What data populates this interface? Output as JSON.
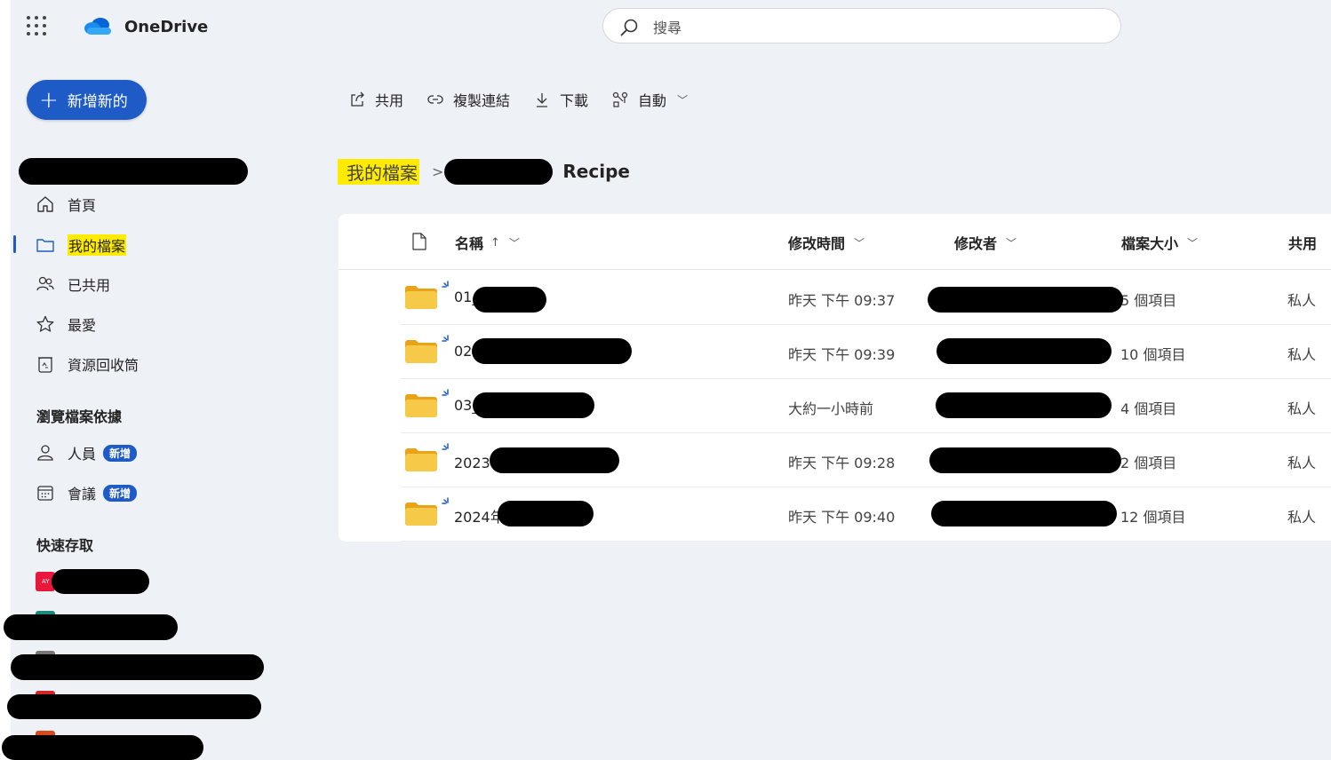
{
  "app": {
    "brand": "OneDrive"
  },
  "search": {
    "placeholder": "搜尋"
  },
  "sidebar": {
    "new_label": "新增新的",
    "items": [
      {
        "label": "首頁"
      },
      {
        "label": "我的檔案"
      },
      {
        "label": "已共用"
      },
      {
        "label": "最愛"
      },
      {
        "label": "資源回收筒"
      }
    ],
    "browse_title": "瀏覽檔案依據",
    "browse_items": [
      {
        "label": "人員",
        "badge": "新增"
      },
      {
        "label": "會議",
        "badge": "新增"
      }
    ],
    "quick_title": "快速存取",
    "quick_first_tile": "AY"
  },
  "commands": [
    {
      "label": "共用",
      "icon": "share-icon"
    },
    {
      "label": "複製連結",
      "icon": "link-icon"
    },
    {
      "label": "下載",
      "icon": "download-icon"
    },
    {
      "label": "自動",
      "icon": "automate-icon"
    }
  ],
  "breadcrumb": {
    "root": "我的檔案",
    "current": "Recipe"
  },
  "table": {
    "headers": {
      "name": "名稱",
      "modified": "修改時間",
      "modified_by": "修改者",
      "size": "檔案大小",
      "sharing": "共用"
    },
    "rows": [
      {
        "name": "01_",
        "modified": "昨天 下午 09:37",
        "size": "5 個項目",
        "sharing": "私人"
      },
      {
        "name": "02",
        "modified": "昨天 下午 09:39",
        "size": "10 個項目",
        "sharing": "私人"
      },
      {
        "name": "03_",
        "modified": "大約一小時前",
        "size": "4 個項目",
        "sharing": "私人"
      },
      {
        "name": "2023年",
        "modified": "昨天 下午 09:28",
        "size": "2 個項目",
        "sharing": "私人"
      },
      {
        "name": "2024年",
        "modified": "昨天 下午 09:40",
        "size": "12 個項目",
        "sharing": "私人"
      }
    ]
  },
  "colors": {
    "accent": "#1f5bc7",
    "highlight": "#ffeb00",
    "folder": "#f7c948"
  }
}
